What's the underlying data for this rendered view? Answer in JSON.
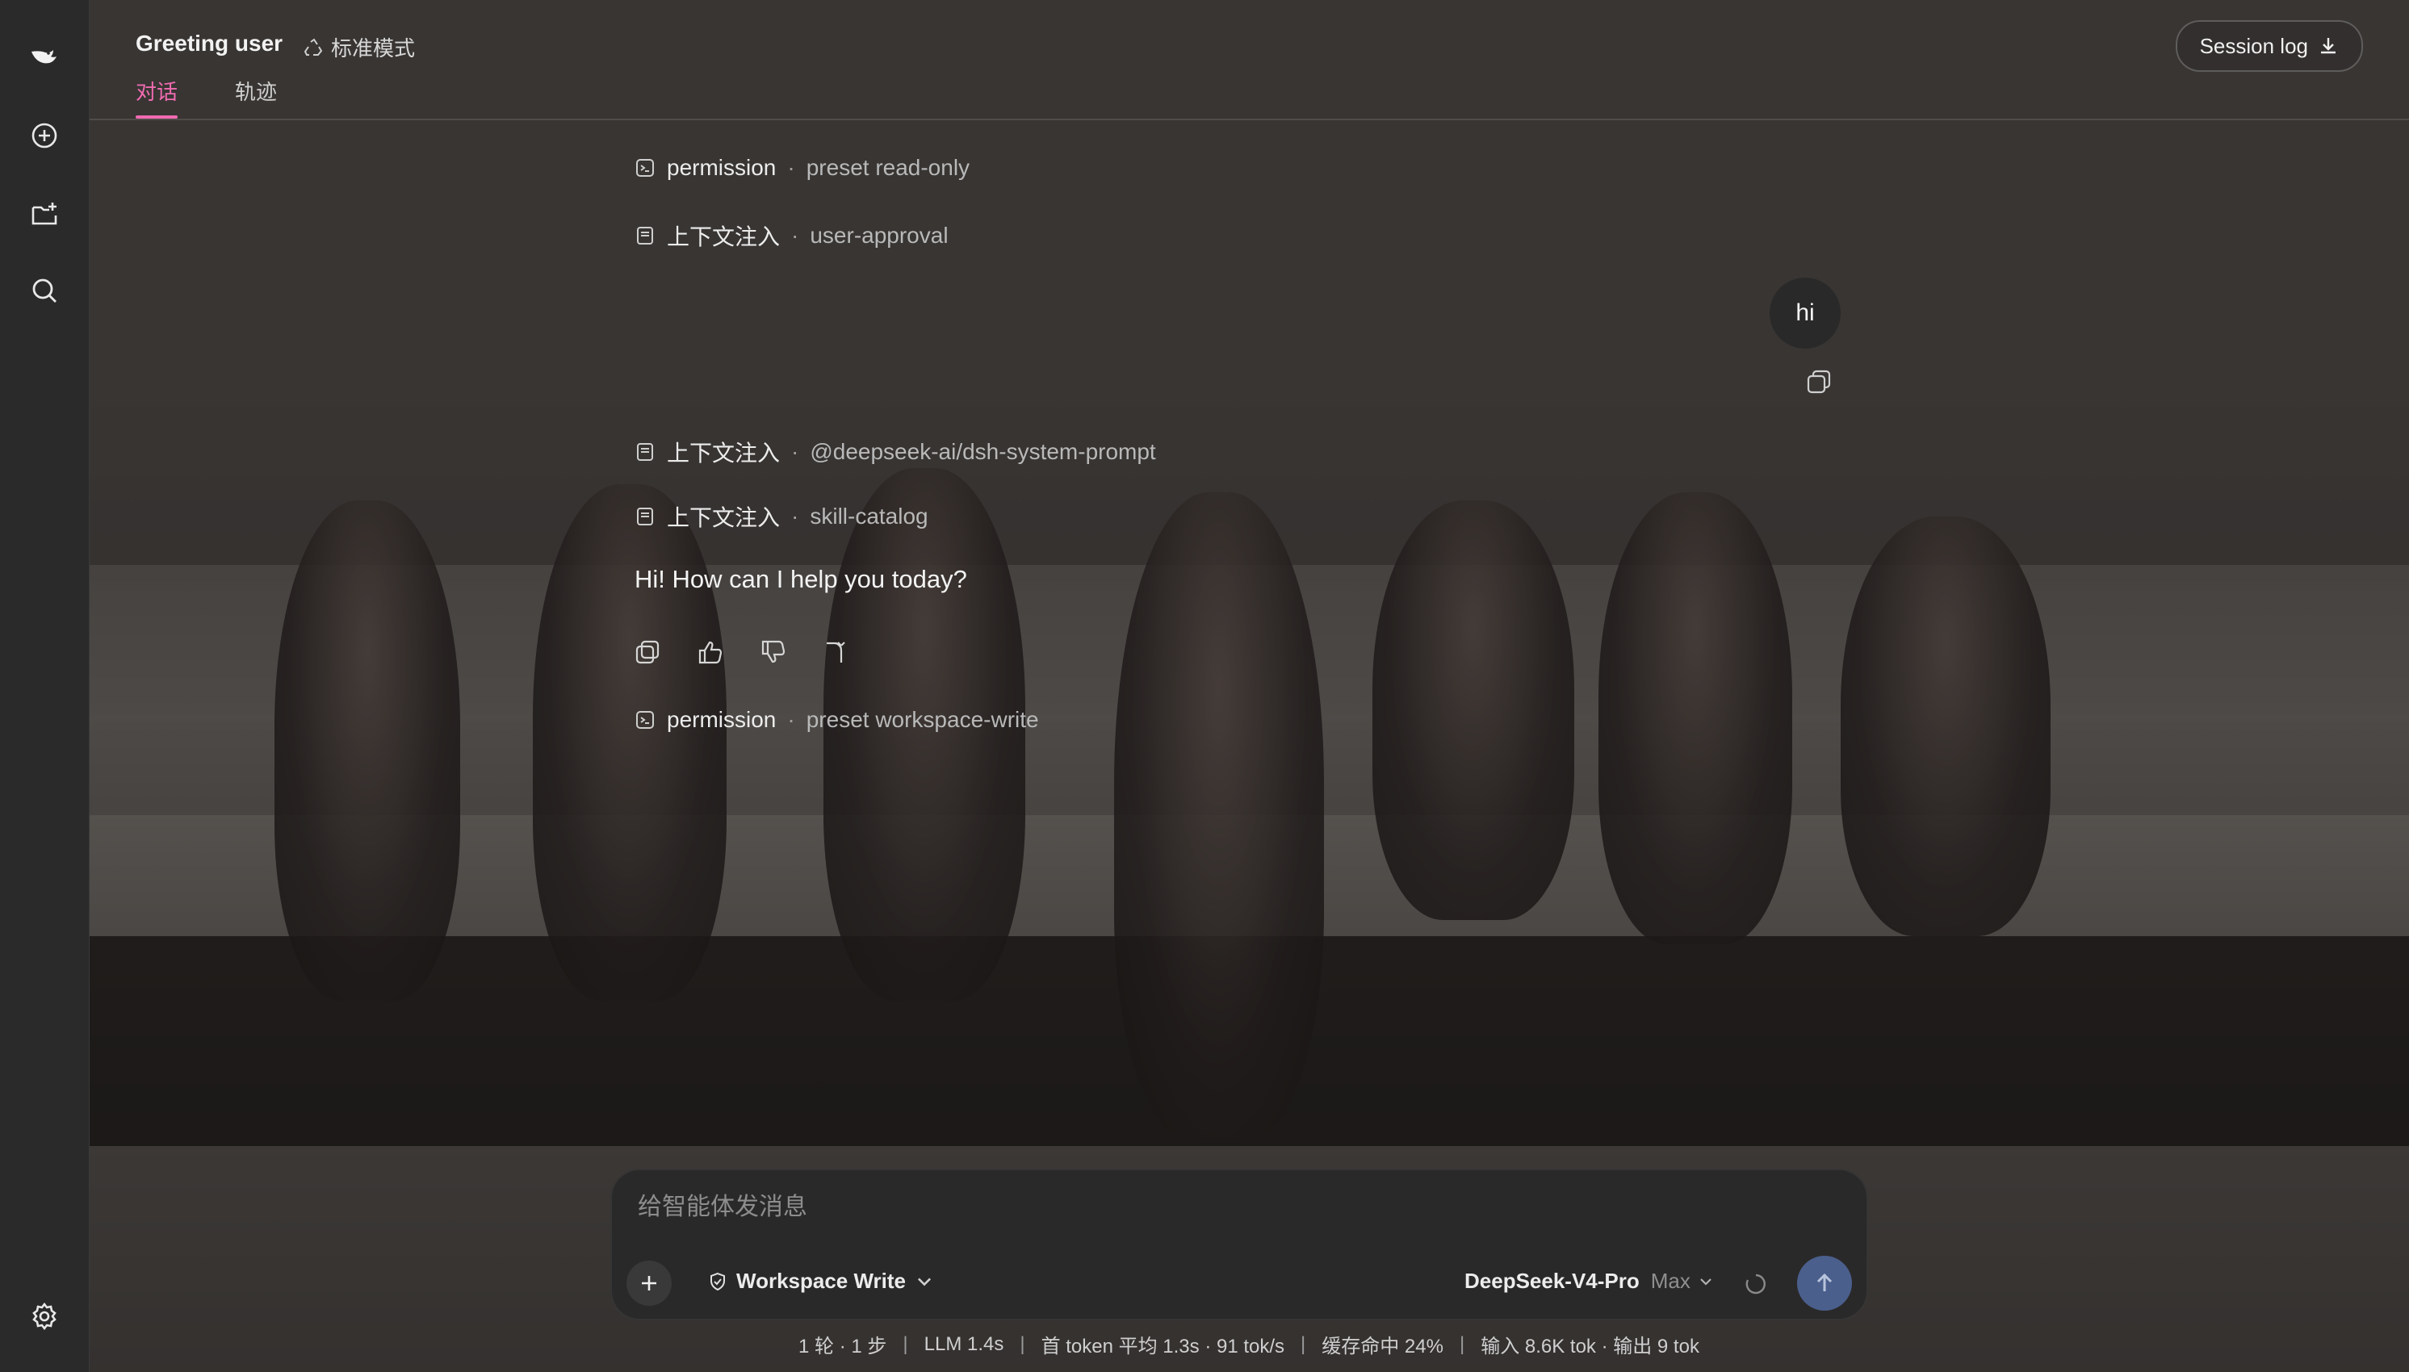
{
  "header": {
    "title": "Greeting user",
    "mode_label": "标准模式",
    "tabs": [
      {
        "label": "对话",
        "active": true
      },
      {
        "label": "轨迹",
        "active": false
      }
    ],
    "session_log_label": "Session log"
  },
  "sidebar": {
    "items": [
      {
        "icon": "logo-icon"
      },
      {
        "icon": "new-chat-icon"
      },
      {
        "icon": "new-project-icon"
      },
      {
        "icon": "search-icon"
      },
      {
        "icon": "settings-icon"
      }
    ]
  },
  "conversation": {
    "events_top": [
      {
        "icon": "terminal-icon",
        "kind": "permission",
        "sep": "·",
        "value": "preset read-only"
      },
      {
        "icon": "document-icon",
        "kind": "上下文注入",
        "sep": "·",
        "value": "user-approval"
      }
    ],
    "user_message": "hi",
    "events_mid": [
      {
        "icon": "document-icon",
        "kind": "上下文注入",
        "sep": "·",
        "value": "@deepseek-ai/dsh-system-prompt"
      },
      {
        "icon": "document-icon",
        "kind": "上下文注入",
        "sep": "·",
        "value": "skill-catalog"
      }
    ],
    "assistant_message": "Hi! How can I help you today?",
    "assistant_actions": [
      "copy-icon",
      "thumbs-up-icon",
      "thumbs-down-icon",
      "branch-icon"
    ],
    "events_bottom": [
      {
        "icon": "terminal-icon",
        "kind": "permission",
        "sep": "·",
        "value": "preset workspace-write"
      }
    ]
  },
  "composer": {
    "placeholder": "给智能体发消息",
    "value": "",
    "permission_label": "Workspace Write",
    "model_name": "DeepSeek-V4-Pro",
    "model_level": "Max"
  },
  "stats": {
    "turns": "1 轮 · 1 步",
    "llm": "LLM 1.4s",
    "first_token": "首 token 平均 1.3s · 91 tok/s",
    "cache": "缓存命中 24%",
    "io": "输入 8.6K tok · 输出 9 tok",
    "separator": "|"
  },
  "colors": {
    "accent_pink": "#f06bb0",
    "send_button": "#4a5f8c",
    "sidebar": "#2b2a2a",
    "composer": "#2a2929"
  }
}
